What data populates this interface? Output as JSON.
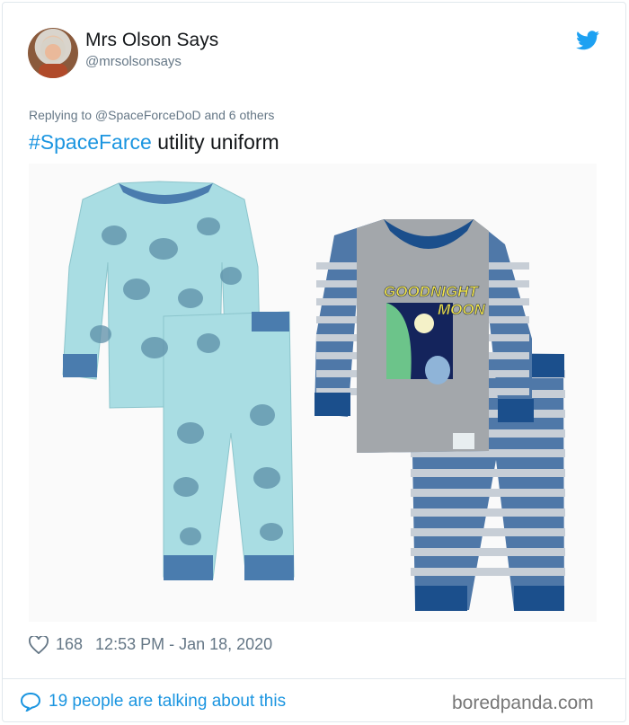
{
  "user": {
    "display_name": "Mrs Olson Says",
    "handle": "@mrsolsonsays"
  },
  "reply_context": "Replying to @SpaceForceDoD and 6 others",
  "tweet": {
    "hashtag": "#SpaceFarce",
    "text": " utility uniform"
  },
  "media": {
    "right_item_print_line1": "GOODNIGHT",
    "right_item_print_line2": "MOON"
  },
  "stats": {
    "likes": "168",
    "timestamp": "12:53 PM - Jan 18, 2020"
  },
  "footer": {
    "talking": "19 people are talking about this",
    "watermark": "boredpanda.com"
  },
  "colors": {
    "link": "#1b95e0",
    "muted": "#657786"
  }
}
